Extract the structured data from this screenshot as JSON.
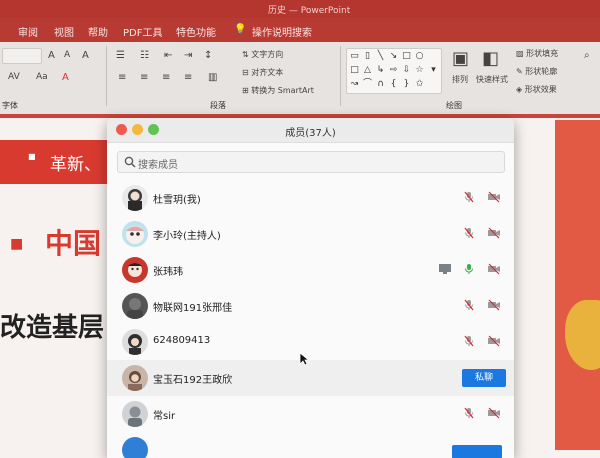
{
  "ppt": {
    "window_title": "历史 — PowerPoint",
    "tabs": [
      "审阅",
      "视图",
      "帮助",
      "PDF工具",
      "特色功能",
      "操作说明搜索"
    ],
    "ribbon": {
      "text_direction": "文字方向",
      "align_text": "对齐文本",
      "convert_smartart": "转换为 SmartArt",
      "paragraph_label": "段落",
      "font_label": "字体",
      "drawing_label": "绘图",
      "arrange": "排列",
      "quick_styles": "快速样式",
      "shape_fill": "形状填充",
      "shape_outline": "形状轮廓",
      "shape_effects": "形状效果"
    },
    "slide": {
      "line1": "革新、",
      "line2": "中国",
      "line3": "改造基层"
    }
  },
  "dialog": {
    "title": "成员(37人)",
    "search_placeholder": "搜索成员",
    "chat_label": "私聊",
    "members": [
      {
        "name": "杜雪玥(我)",
        "mic": "muted",
        "cam": "off",
        "avatar_color": "#3b3b3b"
      },
      {
        "name": "李小玲(主持人)",
        "mic": "muted",
        "cam": "off",
        "avatar_color": "#bfe3ee"
      },
      {
        "name": "张玮玮",
        "mic": "on",
        "cam": "off",
        "screen": true,
        "avatar_color": "#c9372c"
      },
      {
        "name": "物联网191张邢佳",
        "mic": "muted",
        "cam": "off",
        "avatar_color": "#555555"
      },
      {
        "name": "624809413",
        "mic": "muted",
        "cam": "off",
        "avatar_color": "#2f2f2f"
      },
      {
        "name": "宝玉石192王政欣",
        "chat": true,
        "avatar_color": "#6a4a3a"
      },
      {
        "name": "常sir",
        "mic": "muted",
        "cam": "off",
        "avatar_color": "#8a8f96"
      }
    ]
  }
}
